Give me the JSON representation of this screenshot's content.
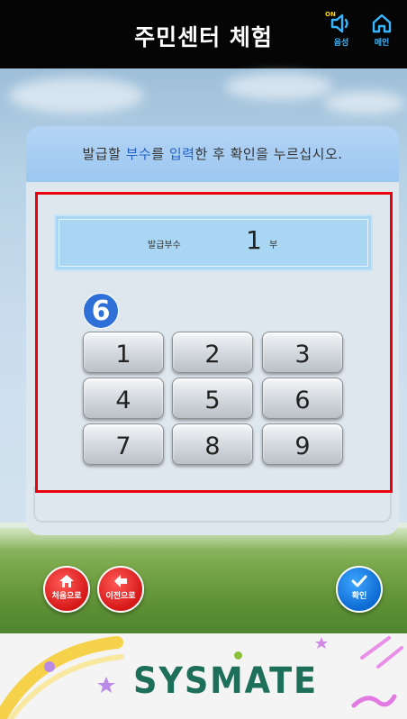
{
  "header": {
    "title": "주민센터 체험",
    "voice_label": "음성",
    "voice_state": "ON",
    "home_label": "메인",
    "voice_icon": "speaker-icon",
    "home_icon": "home-icon"
  },
  "instruction": {
    "part1": "발급할 ",
    "hl1": "부수",
    "part2": "를 ",
    "hl2": "입력",
    "part3": "한 후 확인을 누르십시오."
  },
  "count": {
    "label": "발급부수",
    "value": "1",
    "unit": "부"
  },
  "step_badge": "6",
  "keypad": [
    "1",
    "2",
    "3",
    "4",
    "5",
    "6",
    "7",
    "8",
    "9"
  ],
  "nav": {
    "first_label": "처음으로",
    "prev_label": "이전으로",
    "confirm_label": "확인"
  },
  "footer": {
    "logo_text": "SYSMATE"
  },
  "colors": {
    "header_bg": "#050505",
    "accent_blue": "#37b6ff",
    "highlight_red": "#e8000b",
    "badge_blue": "#2e6fd8",
    "logo_green": "#1e6f59"
  }
}
